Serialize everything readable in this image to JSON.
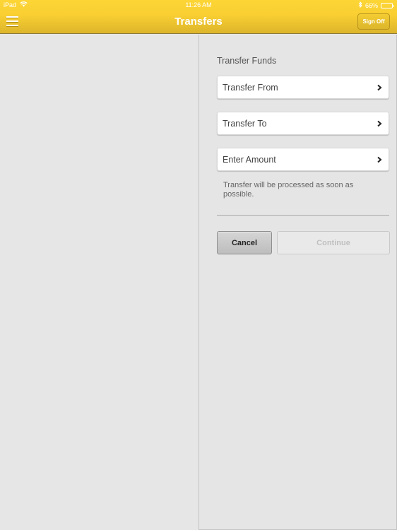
{
  "status_bar": {
    "device": "iPad",
    "time": "11:26 AM",
    "battery_percent": "66%",
    "battery_level": 0.66
  },
  "nav": {
    "title": "Transfers",
    "sign_off_label": "Sign Off",
    "menu_icon": "hamburger-menu-icon"
  },
  "colors": {
    "header_yellow": "#f9cf32",
    "background": "#e6e6e6"
  },
  "transfer_form": {
    "section_title": "Transfer Funds",
    "fields": [
      {
        "label": "Transfer From",
        "icon": "chevron-right-icon"
      },
      {
        "label": "Transfer To",
        "icon": "chevron-right-icon"
      },
      {
        "label": "Enter Amount",
        "icon": "chevron-right-icon"
      }
    ],
    "note": "Transfer will be processed as soon as possible.",
    "cancel_label": "Cancel",
    "continue_label": "Continue"
  }
}
